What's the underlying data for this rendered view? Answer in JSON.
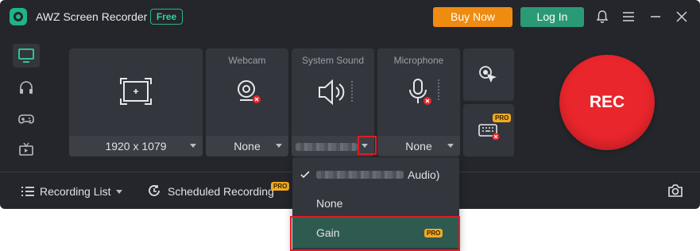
{
  "titlebar": {
    "app_title": "AWZ Screen Recorder",
    "free_badge": "Free",
    "buy_now": "Buy Now",
    "log_in": "Log In"
  },
  "sidebar": {
    "items": [
      {
        "name": "screen",
        "icon": "monitor-icon",
        "active": true
      },
      {
        "name": "audio",
        "icon": "headphones-icon",
        "active": false
      },
      {
        "name": "game",
        "icon": "gamepad-icon",
        "active": false
      },
      {
        "name": "tv",
        "icon": "tv-icon",
        "active": false
      }
    ]
  },
  "cards": {
    "screen": {
      "value": "1920 x 1079"
    },
    "webcam": {
      "label": "Webcam",
      "value": "None"
    },
    "system_sound": {
      "label": "System Sound"
    },
    "microphone": {
      "label": "Microphone",
      "value": "None"
    }
  },
  "rec_button": {
    "label": "REC"
  },
  "bottom": {
    "recording_list": "Recording List",
    "scheduled_recording": "Scheduled Recording",
    "pro_badge": "PRO"
  },
  "dropdown": {
    "items": [
      {
        "label": "Audio)",
        "checked": true
      },
      {
        "label": "None",
        "checked": false
      },
      {
        "label": "Gain",
        "checked": false,
        "badge": "PRO",
        "highlighted": true
      }
    ]
  },
  "colors": {
    "background": "#24262b",
    "card": "#33363c",
    "accent_green": "#2a9a76",
    "buy_orange": "#ef8b10",
    "rec_red": "#e9262c",
    "pro_gold": "#f2a922",
    "highlight_red": "#e31b23"
  }
}
